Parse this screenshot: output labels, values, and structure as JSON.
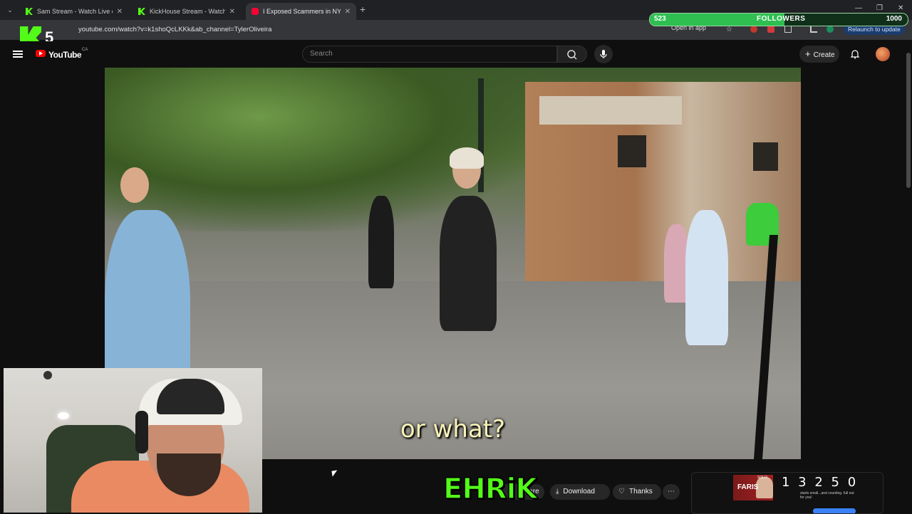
{
  "browser": {
    "tabs": [
      {
        "title": "Sam Stream - Watch Live on Ki",
        "favicon": "kick-icon",
        "active": false
      },
      {
        "title": "KickHouse Stream - Watch Live",
        "favicon": "kick-icon",
        "active": false
      },
      {
        "title": "I Exposed Scammers in NYC",
        "favicon": "youtube-icon",
        "active": true
      }
    ],
    "url": "youtube.com/watch?v=k1shoQcLKKk&ab_channel=TylerOliveira",
    "open_in_app": "Open in app",
    "relaunch": "Relaunch to update"
  },
  "overlay": {
    "followers_count": "523",
    "followers_label": "FOLLOWERS",
    "followers_goal": "1000",
    "followers_progress": 0.523,
    "kick_badge_number": "5",
    "streamer_name": "EHRiK"
  },
  "youtube": {
    "logo_text": "YouTube",
    "region": "CA",
    "search_placeholder": "Search",
    "create_label": "Create",
    "subtitle": "or what?",
    "actions": {
      "share": "Share",
      "download": "Download",
      "thanks": "Thanks",
      "more": "⋯"
    }
  },
  "ad": {
    "brand": "FARIS",
    "solo": "SOLO",
    "counter": "1 3 2 5 0",
    "tagline": "starts small...and counting. full out for you!"
  },
  "colors": {
    "kick_green": "#53fc18",
    "youtube_red": "#ff0000",
    "background": "#0f0f0f"
  }
}
